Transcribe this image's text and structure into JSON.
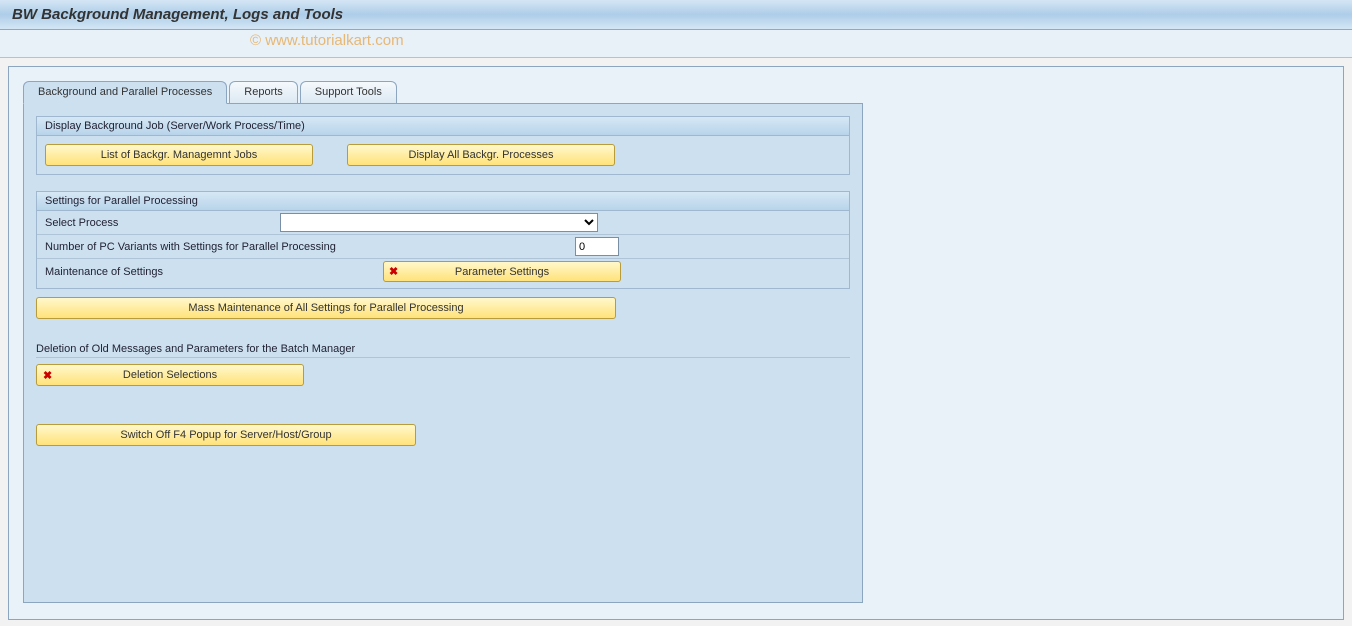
{
  "window": {
    "title": "BW Background Management, Logs and Tools"
  },
  "watermark": "© www.tutorialkart.com",
  "tabs": [
    {
      "label": "Background and Parallel Processes",
      "active": true
    },
    {
      "label": "Reports",
      "active": false
    },
    {
      "label": "Support Tools",
      "active": false
    }
  ],
  "group1": {
    "header": "Display Background Job (Server/Work Process/Time)",
    "btn_list_jobs": "List of Backgr. Managemnt Jobs",
    "btn_display_all": "Display All Backgr. Processes"
  },
  "group2": {
    "header": "Settings for Parallel Processing",
    "select_process_label": "Select Process",
    "select_process_value": "",
    "pc_variants_label": "Number of PC Variants with Settings for Parallel Processing",
    "pc_variants_value": "0",
    "maintenance_label": "Maintenance of Settings",
    "parameter_settings_btn": "Parameter Settings",
    "mass_maintenance_btn": "Mass Maintenance of All Settings for Parallel Processing"
  },
  "deletion": {
    "header": "Deletion of Old Messages and Parameters for the Batch Manager",
    "deletion_btn": "Deletion Selections"
  },
  "switch_off_btn": "Switch Off F4 Popup for Server/Host/Group",
  "icons": {
    "cancel": "✖"
  }
}
